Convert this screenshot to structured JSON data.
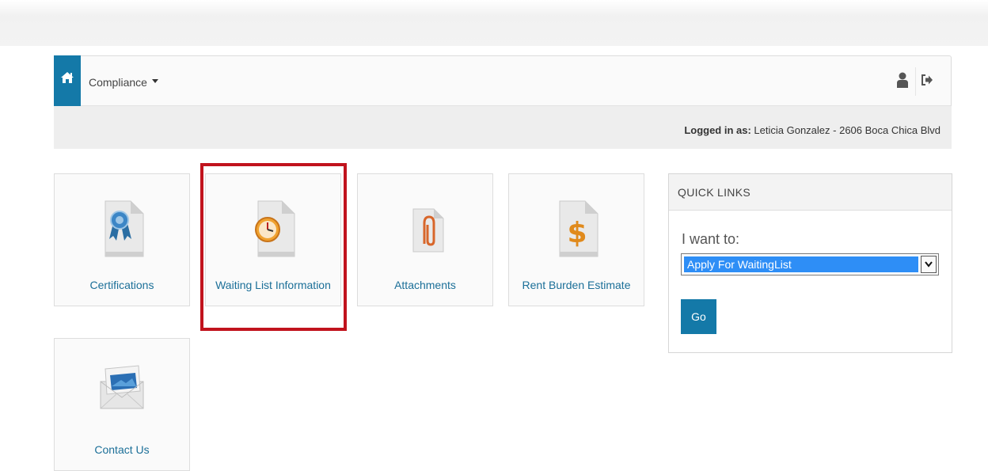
{
  "navbar": {
    "home_icon": "home-icon",
    "menu_label": "Compliance",
    "user_icon": "user-icon",
    "signout_icon": "sign-out-icon"
  },
  "login": {
    "prefix": "Logged in as:",
    "user": " Leticia Gonzalez - 2606 Boca Chica Blvd"
  },
  "tiles": [
    {
      "label": "Certifications",
      "icon": "certificate-ribbon-icon"
    },
    {
      "label": "Waiting List Information",
      "icon": "clock-document-icon",
      "highlighted": true
    },
    {
      "label": "Attachments",
      "icon": "paperclip-document-icon"
    },
    {
      "label": "Rent Burden Estimate",
      "icon": "dollar-document-icon"
    },
    {
      "label": "Contact Us",
      "icon": "envelope-icon"
    }
  ],
  "quick_links": {
    "title": "QUICK LINKS",
    "prompt": "I want to:",
    "selected": "Apply For WaitingList",
    "go_label": "Go"
  },
  "colors": {
    "accent": "#1479a8",
    "link": "#1b6f98",
    "highlight_border": "#c1131d",
    "select_highlight": "#2e8ef6"
  }
}
